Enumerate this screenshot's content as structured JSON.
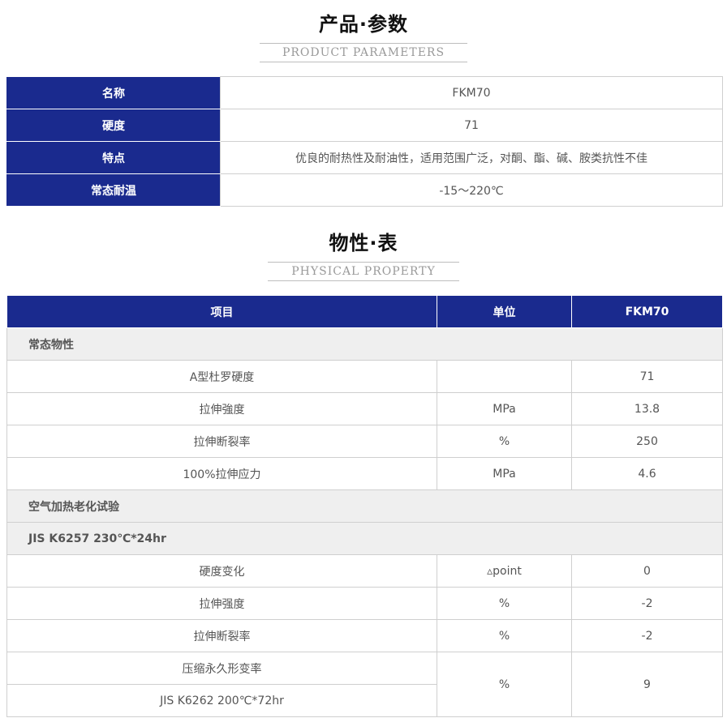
{
  "params_section": {
    "title": "产品·参数",
    "subtitle": "PRODUCT PARAMETERS",
    "rows": [
      {
        "label": "名称",
        "value": "FKM70"
      },
      {
        "label": "硬度",
        "value": "71"
      },
      {
        "label": "特点",
        "value": "优良的耐热性及耐油性，适用范围广泛，对酮、酯、碱、胺类抗性不佳"
      },
      {
        "label": "常态耐温",
        "value": "-15～220℃"
      }
    ]
  },
  "property_section": {
    "title": "物性·表",
    "subtitle": "PHYSICAL PROPERTY",
    "headers": {
      "item": "项目",
      "unit": "单位",
      "value": "FKM70"
    },
    "group1": "常态物性",
    "rows1": [
      {
        "item": "A型杜罗硬度",
        "unit": "",
        "value": "71"
      },
      {
        "item": "拉伸強度",
        "unit": "MPa",
        "value": "13.8"
      },
      {
        "item": "拉伸断裂率",
        "unit": "%",
        "value": "250"
      },
      {
        "item": "100%拉伸应力",
        "unit": "MPa",
        "value": "4.6"
      }
    ],
    "group2": "空气加热老化试验",
    "group3": "JIS K6257 230℃*24hr",
    "rows2": [
      {
        "item": "硬度变化",
        "unit": "▵point",
        "value": "0"
      },
      {
        "item": "拉伸强度",
        "unit": "%",
        "value": "-2"
      },
      {
        "item": "拉伸断裂率",
        "unit": "%",
        "value": "-2"
      }
    ],
    "compression": {
      "item": "压缩永久形变率",
      "condition": "JIS K6262 200℃*72hr",
      "unit": "%",
      "value": "9"
    }
  }
}
